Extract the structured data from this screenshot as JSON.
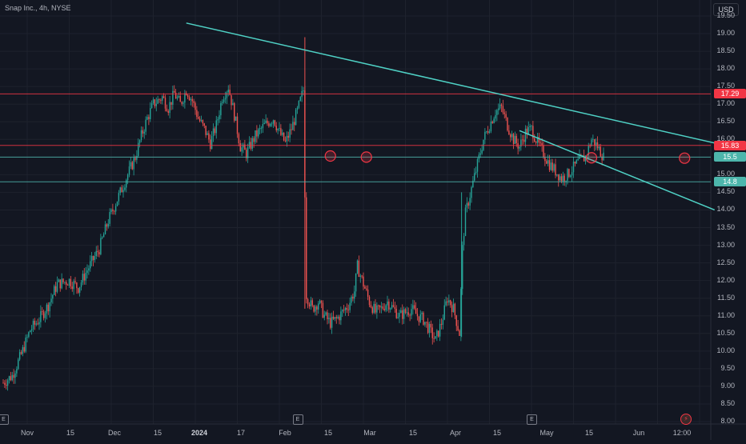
{
  "header": {
    "symbol_label": "Snap Inc., 4h, NYSE"
  },
  "currency": "USD",
  "colors": {
    "background": "#131722",
    "up": "#26a69a",
    "down": "#ef5350",
    "resistance": "#f23645",
    "support": "#4db6ac",
    "trendline": "#4fd1c5"
  },
  "chart_data": {
    "type": "candlestick",
    "ylim": [
      8.0,
      19.5
    ],
    "y_ticks": [
      "19.50",
      "19.00",
      "18.50",
      "18.00",
      "17.50",
      "17.00",
      "16.50",
      "16.00",
      "15.50",
      "15.00",
      "14.50",
      "14.00",
      "13.50",
      "13.00",
      "12.50",
      "12.00",
      "11.50",
      "11.00",
      "10.50",
      "10.00",
      "9.50",
      "9.00",
      "8.50",
      "8.00"
    ],
    "x_ticks": [
      {
        "label": "Nov",
        "bold": false
      },
      {
        "label": "15",
        "bold": false
      },
      {
        "label": "Dec",
        "bold": false
      },
      {
        "label": "15",
        "bold": false
      },
      {
        "label": "2024",
        "bold": true
      },
      {
        "label": "17",
        "bold": false
      },
      {
        "label": "Feb",
        "bold": false
      },
      {
        "label": "15",
        "bold": false
      },
      {
        "label": "Mar",
        "bold": false
      },
      {
        "label": "15",
        "bold": false
      },
      {
        "label": "Apr",
        "bold": false
      },
      {
        "label": "15",
        "bold": false
      },
      {
        "label": "May",
        "bold": false
      },
      {
        "label": "15",
        "bold": false
      },
      {
        "label": "Jun",
        "bold": false
      },
      {
        "label": "12:00",
        "bold": false
      }
    ],
    "horizontal_lines": [
      {
        "price": 17.29,
        "color": "#f23645",
        "label": "17.29"
      },
      {
        "price": 15.83,
        "color": "#f23645",
        "label": "15.83"
      },
      {
        "price": 15.5,
        "color": "#4db6ac",
        "label": "15.5"
      },
      {
        "price": 14.8,
        "color": "#4db6ac",
        "label": "14.8"
      }
    ],
    "trendlines": [
      {
        "from_day": 61,
        "from_price": 19.3,
        "to_day": 237,
        "to_price": 15.9
      },
      {
        "from_day": 172,
        "from_price": 16.25,
        "to_day": 237,
        "to_price": 14.0
      }
    ],
    "touch_markers": [
      {
        "day": 109,
        "price": 15.53
      },
      {
        "day": 121,
        "price": 15.5
      },
      {
        "day": 196,
        "price": 15.48
      },
      {
        "day": 227,
        "price": 15.47
      }
    ],
    "event_markers": [
      {
        "day": 0,
        "glyph": "E"
      },
      {
        "day": 98,
        "glyph": "E"
      },
      {
        "day": 176,
        "glyph": "E"
      }
    ],
    "price_path": [
      [
        0,
        9.1
      ],
      [
        3,
        9.3
      ],
      [
        6,
        9.9
      ],
      [
        9,
        10.6
      ],
      [
        12,
        10.9
      ],
      [
        15,
        11.3
      ],
      [
        18,
        11.9
      ],
      [
        22,
        12.0
      ],
      [
        25,
        11.8
      ],
      [
        28,
        12.3
      ],
      [
        32,
        12.9
      ],
      [
        35,
        13.7
      ],
      [
        38,
        14.3
      ],
      [
        41,
        14.9
      ],
      [
        44,
        15.5
      ],
      [
        46,
        16.1
      ],
      [
        48,
        16.6
      ],
      [
        50,
        17.0
      ],
      [
        53,
        17.2
      ],
      [
        55,
        16.9
      ],
      [
        57,
        17.3
      ],
      [
        59,
        17.0
      ],
      [
        61,
        17.4
      ],
      [
        63,
        17.1
      ],
      [
        65,
        16.6
      ],
      [
        67,
        16.3
      ],
      [
        69,
        15.9
      ],
      [
        71,
        16.4
      ],
      [
        73,
        17.2
      ],
      [
        75,
        17.5
      ],
      [
        77,
        16.7
      ],
      [
        79,
        15.8
      ],
      [
        81,
        15.6
      ],
      [
        84,
        16.1
      ],
      [
        87,
        16.4
      ],
      [
        90,
        16.6
      ],
      [
        92,
        16.2
      ],
      [
        94,
        15.9
      ],
      [
        96,
        16.3
      ],
      [
        98,
        16.8
      ],
      [
        100,
        17.4
      ],
      [
        101,
        11.6
      ],
      [
        103,
        11.2
      ],
      [
        105,
        11.4
      ],
      [
        107,
        11.0
      ],
      [
        109,
        10.8
      ],
      [
        111,
        10.9
      ],
      [
        113,
        11.1
      ],
      [
        115,
        11.3
      ],
      [
        117,
        11.7
      ],
      [
        118,
        12.4
      ],
      [
        120,
        11.9
      ],
      [
        122,
        11.4
      ],
      [
        124,
        11.1
      ],
      [
        126,
        11.2
      ],
      [
        128,
        11.4
      ],
      [
        130,
        11.2
      ],
      [
        132,
        11.0
      ],
      [
        134,
        11.1
      ],
      [
        136,
        11.2
      ],
      [
        138,
        11.0
      ],
      [
        140,
        10.9
      ],
      [
        142,
        10.6
      ],
      [
        144,
        10.3
      ],
      [
        146,
        10.8
      ],
      [
        148,
        11.5
      ],
      [
        150,
        11.2
      ],
      [
        152,
        10.5
      ],
      [
        153,
        12.9
      ],
      [
        154,
        13.9
      ],
      [
        156,
        14.6
      ],
      [
        158,
        15.3
      ],
      [
        160,
        16.0
      ],
      [
        162,
        16.4
      ],
      [
        164,
        16.8
      ],
      [
        166,
        16.9
      ],
      [
        168,
        16.4
      ],
      [
        170,
        16.0
      ],
      [
        172,
        15.8
      ],
      [
        174,
        16.2
      ],
      [
        176,
        16.3
      ],
      [
        178,
        15.9
      ],
      [
        180,
        15.6
      ],
      [
        182,
        15.3
      ],
      [
        184,
        15.1
      ],
      [
        186,
        14.9
      ],
      [
        188,
        15.0
      ],
      [
        190,
        15.2
      ],
      [
        192,
        15.4
      ],
      [
        194,
        15.5
      ],
      [
        196,
        16.0
      ],
      [
        198,
        15.8
      ],
      [
        200,
        15.5
      ]
    ]
  }
}
